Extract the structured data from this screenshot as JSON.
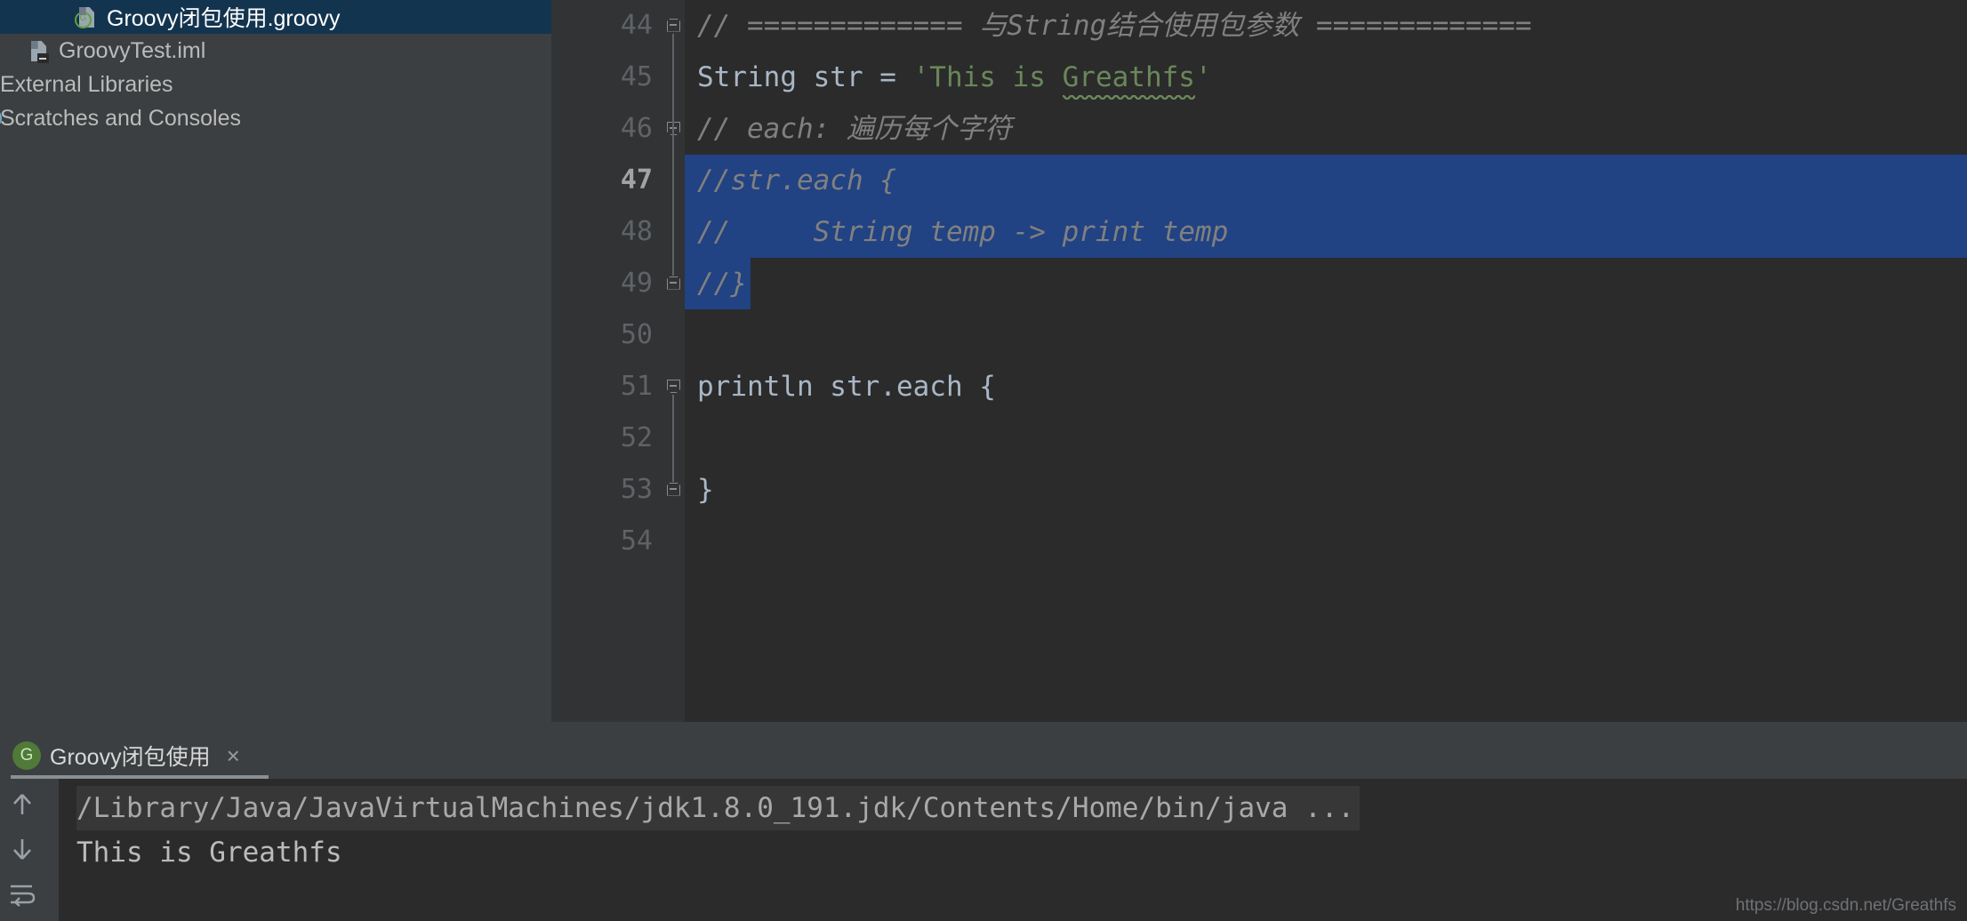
{
  "project_tree": {
    "items": [
      {
        "label": "Groovy闭包使用.groovy",
        "icon": "groovy-file-icon",
        "selected": true,
        "indent": 2
      },
      {
        "label": "GroovyTest.iml",
        "icon": "module-file-icon",
        "selected": false,
        "indent": 1
      },
      {
        "label": "External Libraries",
        "icon": "library-icon",
        "selected": false,
        "indent": 1
      },
      {
        "label": "Scratches and Consoles",
        "icon": "scratches-icon",
        "selected": false,
        "indent": 1
      }
    ]
  },
  "editor": {
    "file_name": "Groovy闭包使用.groovy",
    "current_line": 47,
    "lines": [
      {
        "number": "44",
        "fold": "up",
        "selected": false,
        "tokens": [
          {
            "text": "// ============= 与String结合使用包参数 =============",
            "cls": "cmt"
          }
        ]
      },
      {
        "number": "45",
        "fold": "",
        "selected": false,
        "tokens": [
          {
            "text": "String",
            "cls": "typ"
          },
          {
            "text": " str = ",
            "cls": "plain"
          },
          {
            "text": "'This is ",
            "cls": "str"
          },
          {
            "text": "Greathfs",
            "cls": "str squiggle"
          },
          {
            "text": "'",
            "cls": "str"
          }
        ]
      },
      {
        "number": "46",
        "fold": "down",
        "selected": false,
        "tokens": [
          {
            "text": "// each: 遍历每个字符",
            "cls": "cmt"
          }
        ]
      },
      {
        "number": "47",
        "fold": "",
        "selected": true,
        "sel_width": 1442,
        "tokens": [
          {
            "text": "//",
            "cls": "cmt"
          },
          {
            "text": "str.each {",
            "cls": "cmt sel"
          }
        ]
      },
      {
        "number": "48",
        "fold": "",
        "selected": true,
        "sel_width": 1442,
        "tokens": [
          {
            "text": "//     String temp -> print temp",
            "cls": "cmt sel"
          }
        ]
      },
      {
        "number": "49",
        "fold": "up",
        "selected": true,
        "sel_width": 74,
        "tokens": [
          {
            "text": "//}",
            "cls": "cmt sel"
          }
        ]
      },
      {
        "number": "50",
        "fold": "",
        "selected": false,
        "tokens": []
      },
      {
        "number": "51",
        "fold": "down",
        "selected": false,
        "tokens": [
          {
            "text": "println str.each {",
            "cls": "plain"
          }
        ]
      },
      {
        "number": "52",
        "fold": "",
        "selected": false,
        "tokens": []
      },
      {
        "number": "53",
        "fold": "up",
        "selected": false,
        "tokens": [
          {
            "text": "}",
            "cls": "plain"
          }
        ]
      },
      {
        "number": "54",
        "fold": "",
        "selected": false,
        "tokens": []
      }
    ]
  },
  "run_panel": {
    "tab_label": "Groovy闭包使用",
    "tab_badge": "G",
    "tab_close": "×",
    "sidebar_icons": [
      {
        "name": "scroll-up-icon",
        "glyph": "↑"
      },
      {
        "name": "scroll-down-icon",
        "glyph": "↓"
      },
      {
        "name": "soft-wrap-icon",
        "glyph": "↵"
      }
    ],
    "console_lines": [
      {
        "text": "/Library/Java/JavaVirtualMachines/jdk1.8.0_191.jdk/Contents/Home/bin/java ...",
        "kind": "command"
      },
      {
        "text": "This is Greathfs",
        "kind": "output"
      }
    ]
  },
  "watermark": "https://blog.csdn.net/Greathfs",
  "colors": {
    "editor_bg": "#2b2b2b",
    "panel_bg": "#3c3f41",
    "gutter_bg": "#313335",
    "selection": "#214283",
    "tree_selection": "#13344f",
    "comment": "#808080",
    "string": "#6a8759",
    "code_default": "#a9b7c6"
  }
}
